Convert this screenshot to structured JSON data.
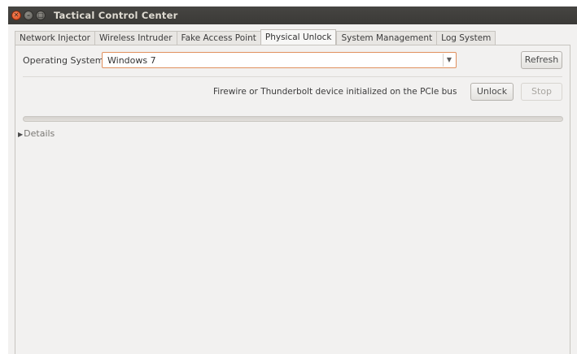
{
  "window": {
    "title": "Tactical Control Center"
  },
  "tabs": [
    {
      "label": "Network Injector",
      "active": false
    },
    {
      "label": "Wireless Intruder",
      "active": false
    },
    {
      "label": "Fake Access Point",
      "active": false
    },
    {
      "label": "Physical Unlock",
      "active": true
    },
    {
      "label": "System Management",
      "active": false
    },
    {
      "label": "Log System",
      "active": false
    }
  ],
  "physical_unlock": {
    "os_label": "Operating System:",
    "os_selected": "Windows 7",
    "refresh_label": "Refresh",
    "status_text": "Firewire or Thunderbolt device initialized on the PCIe bus",
    "unlock_label": "Unlock",
    "stop_label": "Stop",
    "progress": 0,
    "details_label": "Details"
  },
  "colors": {
    "accent": "#e0905e",
    "titlebar": "#3b3a37",
    "close": "#e0481a"
  }
}
